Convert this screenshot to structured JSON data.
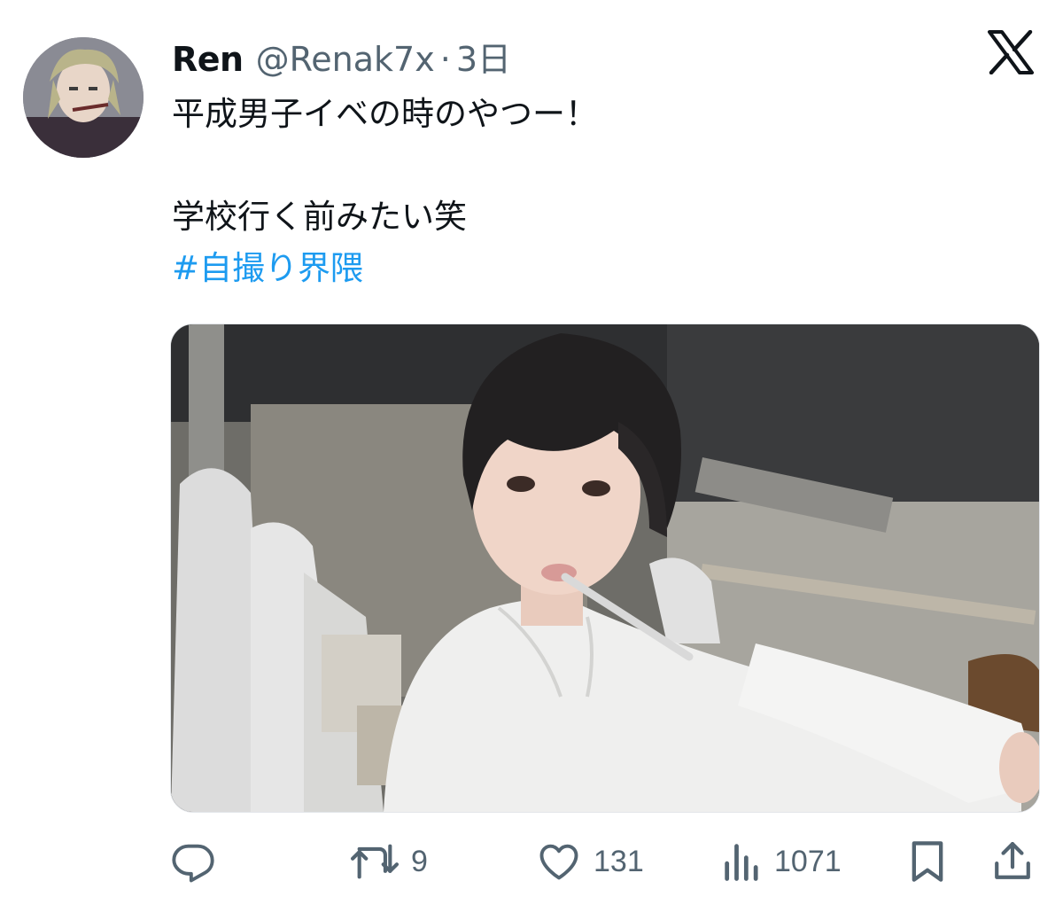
{
  "author": {
    "display_name": "Ren",
    "handle": "@Renak7x",
    "separator": "·",
    "time": "3日"
  },
  "tweet": {
    "lines": [
      "平成男子イベの時のやつー！",
      "",
      "学校行く前みたい笑"
    ],
    "hashtag": "#自撮り界隈"
  },
  "actions": {
    "reply": {
      "icon": "reply-icon"
    },
    "retweet": {
      "icon": "retweet-icon",
      "count": "9"
    },
    "like": {
      "icon": "heart-icon",
      "count": "131"
    },
    "views": {
      "icon": "views-icon",
      "count": "1071"
    },
    "bookmark": {
      "icon": "bookmark-icon"
    },
    "share": {
      "icon": "share-icon"
    }
  },
  "colors": {
    "text": "#0f1419",
    "secondary": "#536471",
    "link": "#1d9bf0"
  }
}
